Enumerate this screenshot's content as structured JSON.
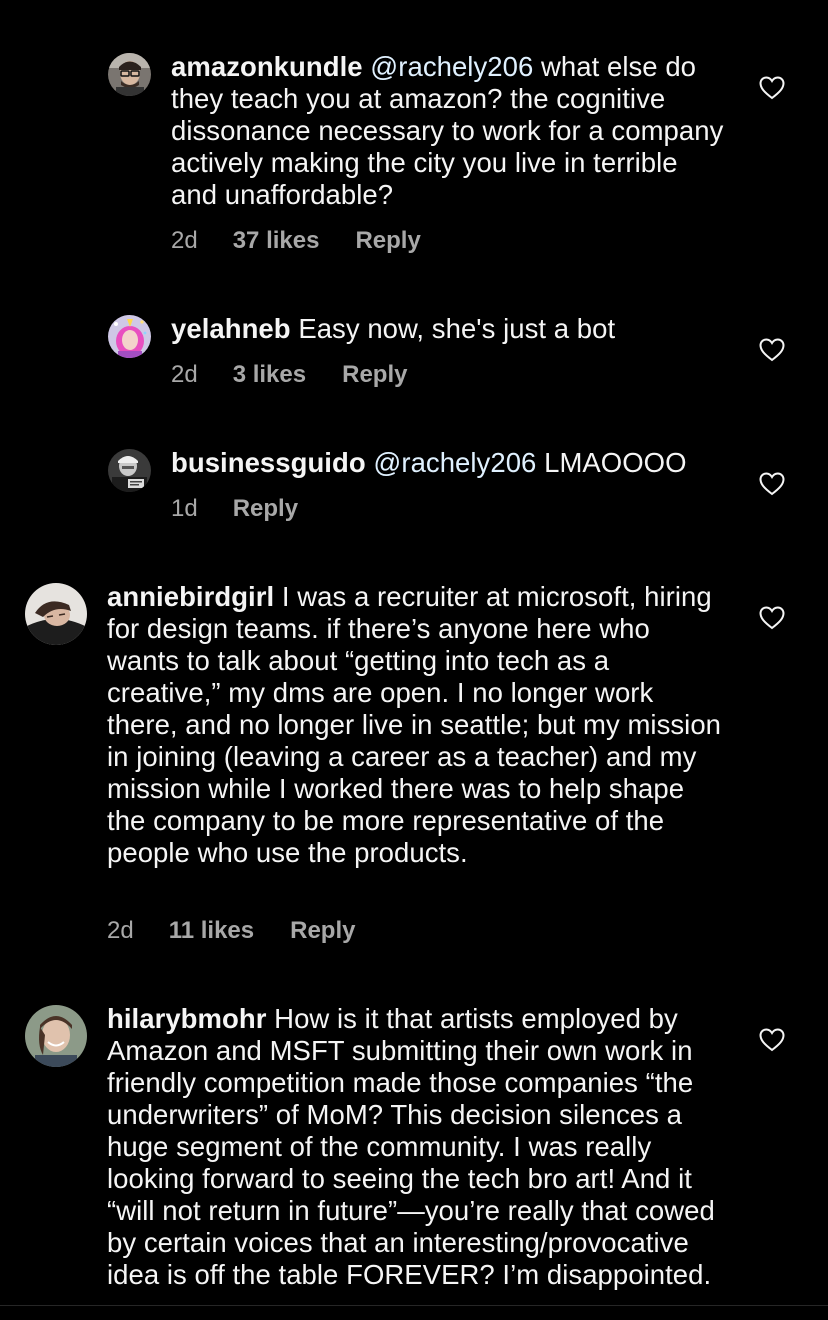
{
  "comments": [
    {
      "username": "amazonkundle",
      "mention": "@rachely206",
      "text": " what else do they teach you at amazon? the cognitive dissonance necessary to work for a company actively making the city you live in terrible and unaffordable?",
      "time": "2d",
      "likes": "37 likes",
      "reply": "Reply",
      "avatar_icon": "profile-photo-man-glasses"
    },
    {
      "username": "yelahneb",
      "mention": "",
      "text": " Easy now, she's just a bot",
      "time": "2d",
      "likes": "3 likes",
      "reply": "Reply",
      "avatar_icon": "profile-photo-pink-hair"
    },
    {
      "username": "businessguido",
      "mention": "@rachely206",
      "text": " LMAOOOO",
      "time": "1d",
      "likes": "",
      "reply": "Reply",
      "avatar_icon": "profile-photo-man-bw"
    },
    {
      "username": "anniebirdgirl",
      "mention": "",
      "text": " I was a recruiter at microsoft, hiring for design teams. if there’s anyone here who wants to talk about “getting into tech as a creative,” my dms are open. I no longer work there, and no longer live in seattle; but my mission in joining (leaving a career as a teacher) and my mission while I worked there was to help shape the company to be more representative of the people who use the products.",
      "time": "2d",
      "likes": "11 likes",
      "reply": "Reply",
      "avatar_icon": "profile-photo-woman-lying"
    },
    {
      "username": "hilarybmohr",
      "mention": "",
      "text": " How is it that artists employed by Amazon and MSFT submitting their own work in friendly competition made those companies “the underwriters” of MoM? This decision silences a huge segment of the community. I was really looking forward to seeing the tech bro art! And it “will not return in future”—you’re really that cowed by certain voices that an interesting/provocative idea is off the table FOREVER? I’m disappointed.",
      "time": "",
      "likes": "",
      "reply": "",
      "avatar_icon": "profile-photo-woman-smiling"
    }
  ],
  "icons": {
    "like": "heart-outline-icon"
  },
  "colors": {
    "background": "#000000",
    "text": "#f5f5f5",
    "meta": "#a8a8a8",
    "mention": "#e0f1ff"
  }
}
